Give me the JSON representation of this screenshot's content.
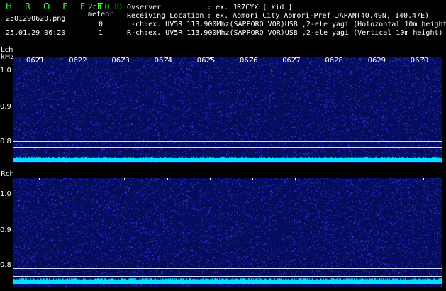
{
  "app": {
    "title": "H R O F F T",
    "version": "2ch 0.30"
  },
  "file": {
    "name": "2501290620.png",
    "datetime": "25.01.29 06:20"
  },
  "meteor": {
    "label": "meteor",
    "lch_count": "0",
    "rch_count": "1"
  },
  "info": {
    "observer_label": "Ovserver",
    "observer_value": ": ex. JR7CYX [ kid ]",
    "location_label": "Receiving Location",
    "location_value": ": ex. Aomori City Aomori-Pref.JAPAN(40.49N, 140.47E)",
    "lch": "L-ch:ex. UV5R 113.900Mhz(SAPPORO VOR)USB ,2-ele yagi (Holozontal 10m height",
    "rch": "R-ch:ex. UV5R 113.900Mhz(SAPPORO VOR)USB ,2-ele yagi (Vertical 10m height)"
  },
  "lch_panel": {
    "label": "Lch",
    "unit": "kHz",
    "yticks": [
      "1.0",
      "0.9",
      "0.8"
    ]
  },
  "rch_panel": {
    "label": "Rch",
    "yticks": [
      "1.0",
      "0.9",
      "0.8"
    ]
  },
  "time_axis": [
    "0621",
    "0622",
    "0623",
    "0624",
    "0625",
    "0626",
    "0627",
    "0628",
    "0629",
    "0630"
  ],
  "colors": {
    "background": "#000000",
    "spectrum": "#050c5a",
    "noise": "#3a4cff",
    "band": "#00e0ff",
    "title": "#3cff3c"
  }
}
